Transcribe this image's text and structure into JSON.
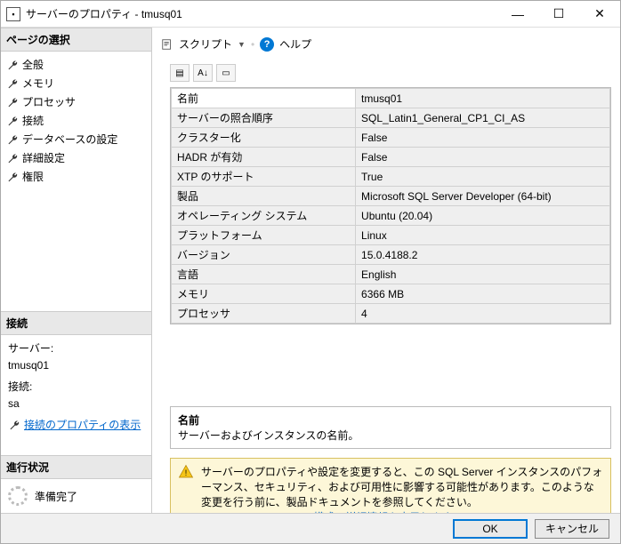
{
  "window": {
    "title": "サーバーのプロパティ - tmusq01"
  },
  "sections": {
    "pages": "ページの選択",
    "connection": "接続",
    "progress": "進行状況"
  },
  "pages": {
    "items": [
      {
        "label": "全般"
      },
      {
        "label": "メモリ"
      },
      {
        "label": "プロセッサ"
      },
      {
        "label": "接続"
      },
      {
        "label": "データベースの設定"
      },
      {
        "label": "詳細設定"
      },
      {
        "label": "権限"
      }
    ]
  },
  "connection": {
    "server_label": "サーバー:",
    "server": "tmusq01",
    "conn_label": "接続:",
    "conn": "sa",
    "link": "接続のプロパティの表示"
  },
  "progress": {
    "status": "準備完了"
  },
  "toolbar": {
    "script": "スクリプト",
    "help": "ヘルプ"
  },
  "props": [
    {
      "label": "名前",
      "value": "tmusq01"
    },
    {
      "label": "サーバーの照合順序",
      "value": "SQL_Latin1_General_CP1_CI_AS"
    },
    {
      "label": "クラスター化",
      "value": "False"
    },
    {
      "label": "HADR が有効",
      "value": "False"
    },
    {
      "label": "XTP のサポート",
      "value": "True"
    },
    {
      "label": "製品",
      "value": "Microsoft SQL Server Developer (64-bit)"
    },
    {
      "label": "オペレーティング システム",
      "value": "Ubuntu (20.04)"
    },
    {
      "label": "プラットフォーム",
      "value": "Linux"
    },
    {
      "label": "バージョン",
      "value": "15.0.4188.2"
    },
    {
      "label": "言語",
      "value": "English"
    },
    {
      "label": "メモリ",
      "value": "6366 MB"
    },
    {
      "label": "プロセッサ",
      "value": "4"
    }
  ],
  "desc": {
    "name": "名前",
    "text": "サーバーおよびインスタンスの名前。"
  },
  "warn": {
    "text": "サーバーのプロパティや設定を変更すると、この SQL Server インスタンスのパフォーマンス、セキュリティ、および可用性に影響する可能性があります。このような変更を行う前に、製品ドキュメントを参照してください。",
    "link": "SQL Server on Linux の構成の詳細情報を表示します(L)。"
  },
  "buttons": {
    "ok": "OK",
    "cancel": "キャンセル"
  }
}
